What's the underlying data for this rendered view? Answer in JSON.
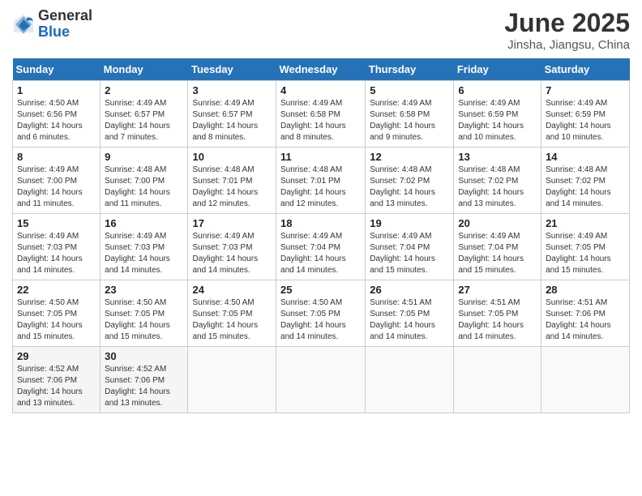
{
  "logo": {
    "general": "General",
    "blue": "Blue"
  },
  "header": {
    "month_year": "June 2025",
    "location": "Jinsha, Jiangsu, China"
  },
  "days_of_week": [
    "Sunday",
    "Monday",
    "Tuesday",
    "Wednesday",
    "Thursday",
    "Friday",
    "Saturday"
  ],
  "weeks": [
    [
      {
        "num": "1",
        "sunrise": "Sunrise: 4:50 AM",
        "sunset": "Sunset: 6:56 PM",
        "daylight": "Daylight: 14 hours and 6 minutes."
      },
      {
        "num": "2",
        "sunrise": "Sunrise: 4:49 AM",
        "sunset": "Sunset: 6:57 PM",
        "daylight": "Daylight: 14 hours and 7 minutes."
      },
      {
        "num": "3",
        "sunrise": "Sunrise: 4:49 AM",
        "sunset": "Sunset: 6:57 PM",
        "daylight": "Daylight: 14 hours and 8 minutes."
      },
      {
        "num": "4",
        "sunrise": "Sunrise: 4:49 AM",
        "sunset": "Sunset: 6:58 PM",
        "daylight": "Daylight: 14 hours and 8 minutes."
      },
      {
        "num": "5",
        "sunrise": "Sunrise: 4:49 AM",
        "sunset": "Sunset: 6:58 PM",
        "daylight": "Daylight: 14 hours and 9 minutes."
      },
      {
        "num": "6",
        "sunrise": "Sunrise: 4:49 AM",
        "sunset": "Sunset: 6:59 PM",
        "daylight": "Daylight: 14 hours and 10 minutes."
      },
      {
        "num": "7",
        "sunrise": "Sunrise: 4:49 AM",
        "sunset": "Sunset: 6:59 PM",
        "daylight": "Daylight: 14 hours and 10 minutes."
      }
    ],
    [
      {
        "num": "8",
        "sunrise": "Sunrise: 4:49 AM",
        "sunset": "Sunset: 7:00 PM",
        "daylight": "Daylight: 14 hours and 11 minutes."
      },
      {
        "num": "9",
        "sunrise": "Sunrise: 4:48 AM",
        "sunset": "Sunset: 7:00 PM",
        "daylight": "Daylight: 14 hours and 11 minutes."
      },
      {
        "num": "10",
        "sunrise": "Sunrise: 4:48 AM",
        "sunset": "Sunset: 7:01 PM",
        "daylight": "Daylight: 14 hours and 12 minutes."
      },
      {
        "num": "11",
        "sunrise": "Sunrise: 4:48 AM",
        "sunset": "Sunset: 7:01 PM",
        "daylight": "Daylight: 14 hours and 12 minutes."
      },
      {
        "num": "12",
        "sunrise": "Sunrise: 4:48 AM",
        "sunset": "Sunset: 7:02 PM",
        "daylight": "Daylight: 14 hours and 13 minutes."
      },
      {
        "num": "13",
        "sunrise": "Sunrise: 4:48 AM",
        "sunset": "Sunset: 7:02 PM",
        "daylight": "Daylight: 14 hours and 13 minutes."
      },
      {
        "num": "14",
        "sunrise": "Sunrise: 4:48 AM",
        "sunset": "Sunset: 7:02 PM",
        "daylight": "Daylight: 14 hours and 14 minutes."
      }
    ],
    [
      {
        "num": "15",
        "sunrise": "Sunrise: 4:49 AM",
        "sunset": "Sunset: 7:03 PM",
        "daylight": "Daylight: 14 hours and 14 minutes."
      },
      {
        "num": "16",
        "sunrise": "Sunrise: 4:49 AM",
        "sunset": "Sunset: 7:03 PM",
        "daylight": "Daylight: 14 hours and 14 minutes."
      },
      {
        "num": "17",
        "sunrise": "Sunrise: 4:49 AM",
        "sunset": "Sunset: 7:03 PM",
        "daylight": "Daylight: 14 hours and 14 minutes."
      },
      {
        "num": "18",
        "sunrise": "Sunrise: 4:49 AM",
        "sunset": "Sunset: 7:04 PM",
        "daylight": "Daylight: 14 hours and 14 minutes."
      },
      {
        "num": "19",
        "sunrise": "Sunrise: 4:49 AM",
        "sunset": "Sunset: 7:04 PM",
        "daylight": "Daylight: 14 hours and 15 minutes."
      },
      {
        "num": "20",
        "sunrise": "Sunrise: 4:49 AM",
        "sunset": "Sunset: 7:04 PM",
        "daylight": "Daylight: 14 hours and 15 minutes."
      },
      {
        "num": "21",
        "sunrise": "Sunrise: 4:49 AM",
        "sunset": "Sunset: 7:05 PM",
        "daylight": "Daylight: 14 hours and 15 minutes."
      }
    ],
    [
      {
        "num": "22",
        "sunrise": "Sunrise: 4:50 AM",
        "sunset": "Sunset: 7:05 PM",
        "daylight": "Daylight: 14 hours and 15 minutes."
      },
      {
        "num": "23",
        "sunrise": "Sunrise: 4:50 AM",
        "sunset": "Sunset: 7:05 PM",
        "daylight": "Daylight: 14 hours and 15 minutes."
      },
      {
        "num": "24",
        "sunrise": "Sunrise: 4:50 AM",
        "sunset": "Sunset: 7:05 PM",
        "daylight": "Daylight: 14 hours and 15 minutes."
      },
      {
        "num": "25",
        "sunrise": "Sunrise: 4:50 AM",
        "sunset": "Sunset: 7:05 PM",
        "daylight": "Daylight: 14 hours and 14 minutes."
      },
      {
        "num": "26",
        "sunrise": "Sunrise: 4:51 AM",
        "sunset": "Sunset: 7:05 PM",
        "daylight": "Daylight: 14 hours and 14 minutes."
      },
      {
        "num": "27",
        "sunrise": "Sunrise: 4:51 AM",
        "sunset": "Sunset: 7:05 PM",
        "daylight": "Daylight: 14 hours and 14 minutes."
      },
      {
        "num": "28",
        "sunrise": "Sunrise: 4:51 AM",
        "sunset": "Sunset: 7:06 PM",
        "daylight": "Daylight: 14 hours and 14 minutes."
      }
    ],
    [
      {
        "num": "29",
        "sunrise": "Sunrise: 4:52 AM",
        "sunset": "Sunset: 7:06 PM",
        "daylight": "Daylight: 14 hours and 13 minutes."
      },
      {
        "num": "30",
        "sunrise": "Sunrise: 4:52 AM",
        "sunset": "Sunset: 7:06 PM",
        "daylight": "Daylight: 14 hours and 13 minutes."
      },
      null,
      null,
      null,
      null,
      null
    ]
  ]
}
